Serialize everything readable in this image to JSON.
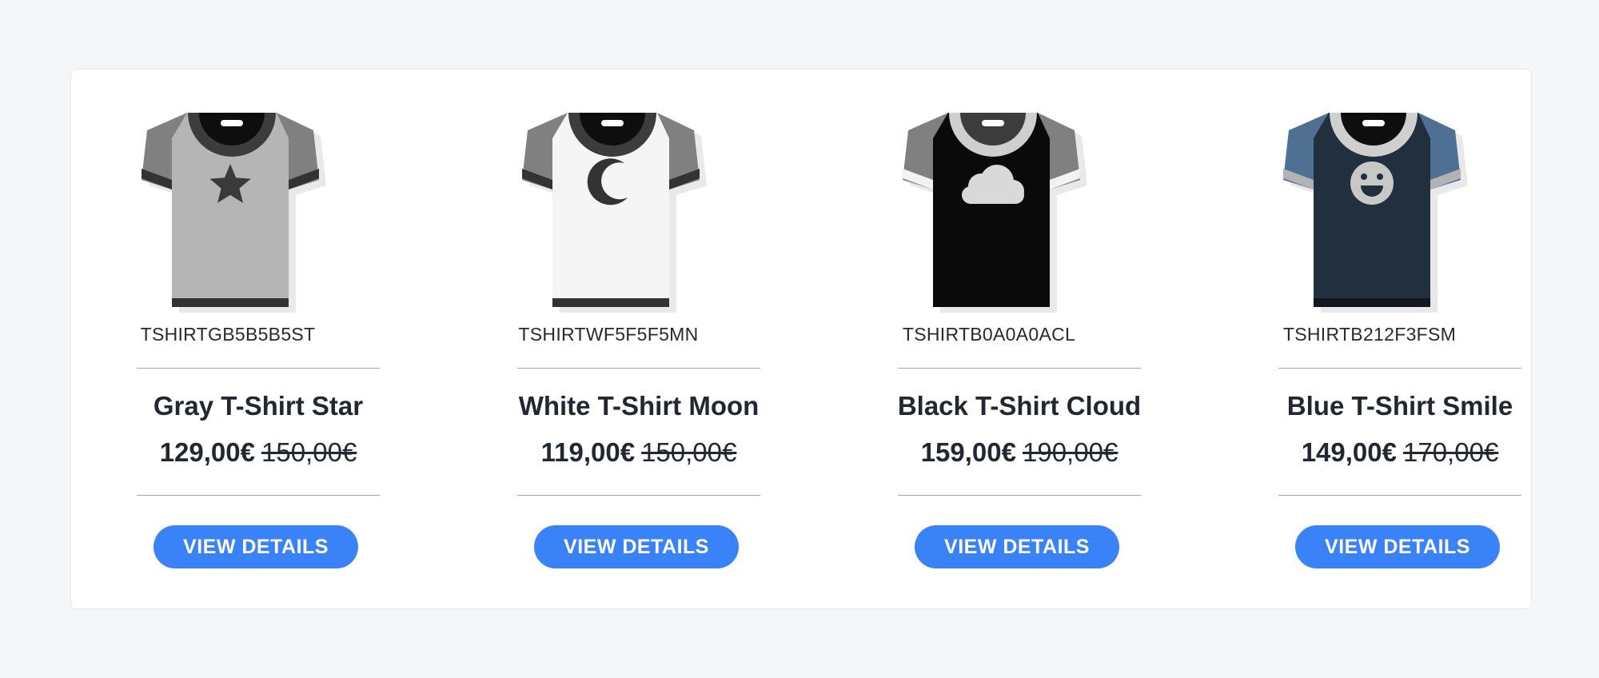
{
  "products": [
    {
      "sku": "TSHIRTGB5B5B5ST",
      "name": "Gray T-Shirt Star",
      "price": "129,00€",
      "old_price": "150,00€",
      "button_label": "VIEW DETAILS",
      "icon": "star-icon",
      "colors": {
        "body": "#b5b5b5",
        "sleeve": "#808080",
        "cuff": "#333333",
        "collar": "#3c3c3c",
        "hem": "#333333",
        "graphic": "#3a3a3a"
      }
    },
    {
      "sku": "TSHIRTWF5F5F5MN",
      "name": "White T-Shirt Moon",
      "price": "119,00€",
      "old_price": "150,00€",
      "button_label": "VIEW DETAILS",
      "icon": "moon-icon",
      "colors": {
        "body": "#f5f5f5",
        "sleeve": "#808080",
        "cuff": "#333333",
        "collar": "#3c3c3c",
        "hem": "#333333",
        "graphic": "#333333"
      }
    },
    {
      "sku": "TSHIRTB0A0A0ACL",
      "name": "Black T-Shirt Cloud",
      "price": "159,00€",
      "old_price": "190,00€",
      "button_label": "VIEW DETAILS",
      "icon": "cloud-icon",
      "colors": {
        "body": "#0a0a0a",
        "sleeve": "#808080",
        "cuff": "#f2f2f2",
        "collar": "#cfcfcf",
        "hem": "#0a0a0a",
        "graphic": "#d9d9d9"
      }
    },
    {
      "sku": "TSHIRTB212F3FSM",
      "name": "Blue T-Shirt Smile",
      "price": "149,00€",
      "old_price": "170,00€",
      "button_label": "VIEW DETAILS",
      "icon": "smile-icon",
      "colors": {
        "body": "#212f3f",
        "sleeve": "#4f6f93",
        "cuff": "#b3b3b3",
        "collar": "#cfcfcf",
        "hem": "#111820",
        "graphic": "#c8c8c8"
      }
    }
  ]
}
